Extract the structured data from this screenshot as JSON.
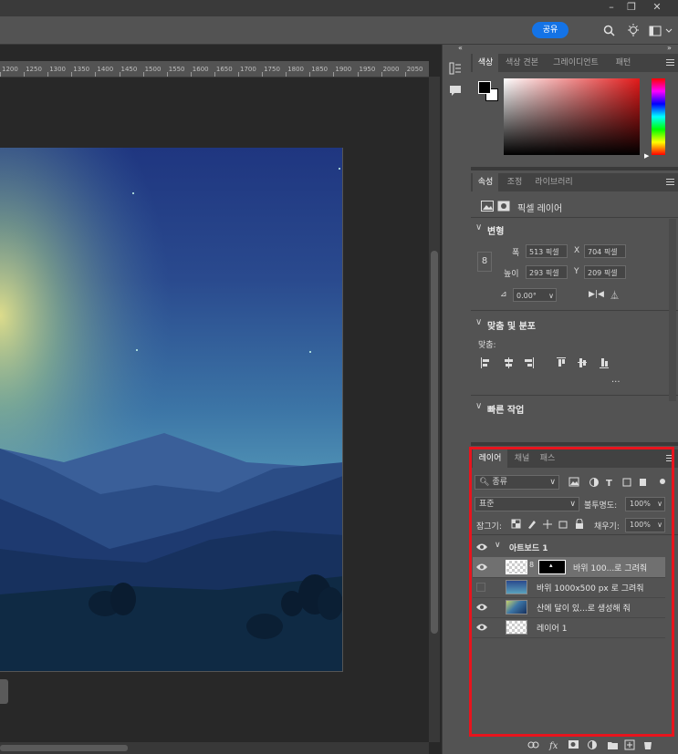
{
  "header": {
    "share_label": "공유",
    "window_controls": [
      "minimize-icon",
      "restore-icon",
      "close-icon"
    ],
    "icons": [
      "search-icon",
      "lightbulb-icon",
      "workspace-icon"
    ]
  },
  "ruler": {
    "ticks": [
      "1200",
      "1250",
      "1300",
      "1350",
      "1400",
      "1450",
      "1500",
      "1550",
      "1600",
      "1650",
      "1700",
      "1750",
      "1800",
      "1850",
      "1900",
      "1950",
      "2000",
      "2050"
    ]
  },
  "color_panel": {
    "tabs": [
      "색상",
      "색상 견본",
      "그레이디언트",
      "패턴"
    ],
    "accent_hue": "#e21a1a"
  },
  "properties_panel": {
    "tabs": [
      "속성",
      "조정",
      "라이브러리"
    ],
    "layer_kind": "픽셀 레이어",
    "transform": {
      "title": "변형",
      "width_label": "폭",
      "width_value": "513 픽셀",
      "height_label": "높이",
      "height_value": "293 픽셀",
      "x_label": "X",
      "x_value": "704 픽셀",
      "y_label": "Y",
      "y_value": "209 픽셀",
      "angle_value": "0.00°"
    },
    "align": {
      "title": "맞춤 및 분포",
      "subtitle": "맞춤:",
      "more": "···"
    },
    "quick_actions": {
      "title": "빠른 작업"
    }
  },
  "layers_panel": {
    "tabs": [
      "레이어",
      "채널",
      "패스"
    ],
    "filter_label": "종류",
    "blend_mode": "표준",
    "opacity_label": "불투명도:",
    "opacity_value": "100%",
    "lock_label": "잠그기:",
    "fill_label": "채우기:",
    "fill_value": "100%",
    "artboard_name": "아트보드 1",
    "layers": [
      {
        "name": "바위 100...로 그려줘",
        "visible": true,
        "selected": true
      },
      {
        "name": "바위 1000x500 px 로 그려줘",
        "visible": false,
        "selected": false
      },
      {
        "name": "산에 달이 있...로 생성해 줘",
        "visible": true,
        "selected": false
      },
      {
        "name": "레이어 1",
        "visible": true,
        "selected": false
      }
    ],
    "highlight_color": "#e8141d"
  }
}
